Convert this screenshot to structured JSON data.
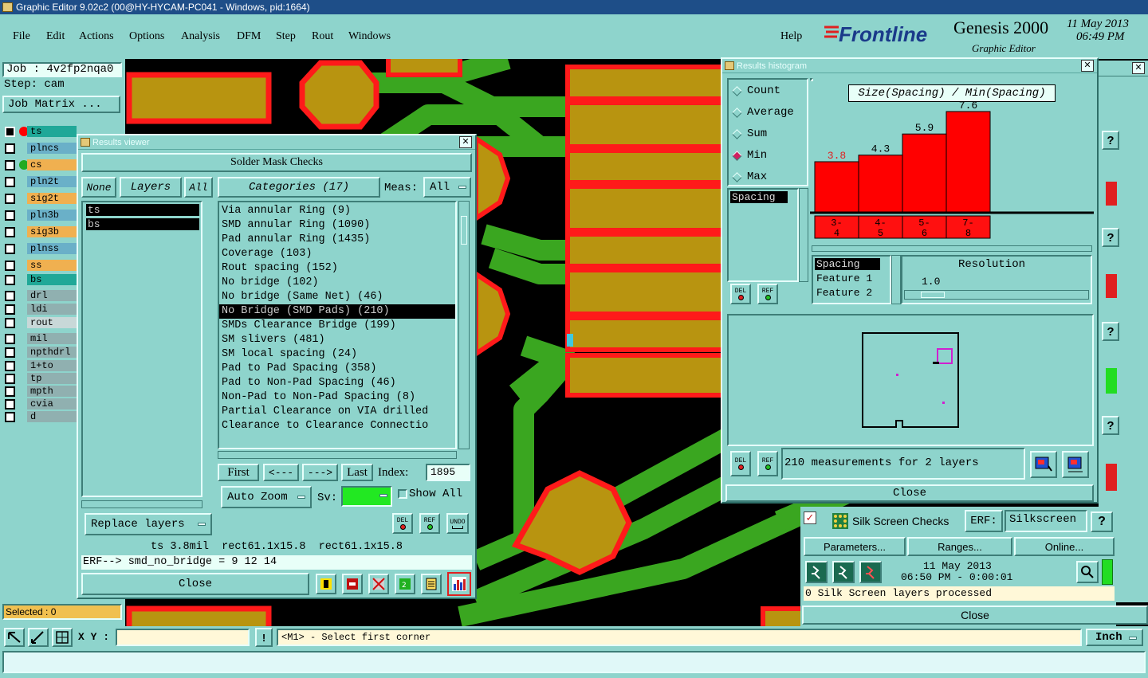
{
  "window": {
    "title": "Graphic Editor 9.02c2 (00@HY-HYCAM-PC041 - Windows, pid:1664)"
  },
  "menu": {
    "items": [
      "File",
      "Edit",
      "Actions",
      "Options",
      "Analysis",
      "DFM",
      "Step",
      "Rout",
      "Windows"
    ],
    "help": "Help"
  },
  "brand": {
    "logo": "Frontline",
    "product": "Genesis 2000",
    "subtitle": "Graphic Editor",
    "date": "11 May 2013",
    "time": "06:49 PM"
  },
  "job": {
    "job": "Job : 4v2fp2nqa0",
    "step": "Step: cam",
    "matrix_button": "Job Matrix ..."
  },
  "layers": [
    {
      "name": "ts",
      "color": "#20a898",
      "dot": "#ff0000"
    },
    {
      "name": "plncs",
      "color": "#6ab0c8"
    },
    {
      "name": "cs",
      "color": "#f0b050",
      "dot": "#22aa22"
    },
    {
      "name": "pln2t",
      "color": "#6ab0c8"
    },
    {
      "name": "sig2t",
      "color": "#f0b050"
    },
    {
      "name": "pln3b",
      "color": "#6ab0c8"
    },
    {
      "name": "sig3b",
      "color": "#f0b050"
    },
    {
      "name": "plnss",
      "color": "#6ab0c8"
    },
    {
      "name": "ss",
      "color": "#f0b050"
    },
    {
      "name": "bs",
      "color": "#20a898"
    },
    {
      "name": "drl",
      "color": "#90b0b0"
    },
    {
      "name": "ldi",
      "color": "#90b0b0"
    },
    {
      "name": "rout",
      "color": "#c8d8d8"
    },
    {
      "name": "mil",
      "color": "#90b0b0"
    },
    {
      "name": "npthdrl",
      "color": "#90b0b0"
    },
    {
      "name": "1+to",
      "color": "#90b0b0"
    },
    {
      "name": "tp",
      "color": "#90b0b0"
    },
    {
      "name": "mpth",
      "color": "#90b0b0"
    },
    {
      "name": "cvia",
      "color": "#90b0b0"
    },
    {
      "name": "d",
      "color": "#90b0b0"
    }
  ],
  "status": {
    "selected": "Selected : 0",
    "xy_label": "X Y :",
    "message": "<M1> - Select first corner",
    "units": "Inch"
  },
  "results_viewer": {
    "title": "Results viewer",
    "header": "Solder Mask Checks",
    "none_btn": "None",
    "layers_btn": "Layers",
    "all_btn": "All",
    "categories_btn": "Categories (17)",
    "meas_label": "Meas:",
    "meas_value": "All",
    "layer_list": [
      "ts",
      "bs"
    ],
    "categories": [
      "Via annular Ring (9)",
      "SMD annular Ring (1090)",
      "Pad annular Ring (1435)",
      "Coverage (103)",
      "Rout spacing (152)",
      "No bridge (102)",
      "No bridge (Same Net) (46)",
      "No Bridge (SMD Pads) (210)",
      "SMDs Clearance Bridge (199)",
      "SM slivers (481)",
      "SM local spacing (24)",
      "Pad to Pad Spacing (358)",
      "Pad to Non-Pad Spacing (46)",
      "Non-Pad to Non-Pad Spacing (8)",
      "Partial Clearance on VIA drilled",
      "Clearance to Clearance Connectio"
    ],
    "selected_index": 7,
    "nav": {
      "first": "First",
      "prev": "<---",
      "next": "--->",
      "last": "Last",
      "index_label": "Index:",
      "index_value": "1895"
    },
    "auto_zoom": "Auto Zoom",
    "sv_label": "Sv:",
    "show_all": "Show All",
    "replace_layers": "Replace layers",
    "del": "DEL",
    "ref": "REF",
    "undo": "UNDO",
    "info_line": "ts 3.8mil  rect61.1x15.8  rect61.1x15.8",
    "erf_line": "ERF--> smd_no_bridge = 9 12 14",
    "close": "Close"
  },
  "histogram": {
    "title": "Results histogram",
    "modes": [
      "Count",
      "Average",
      "Sum",
      "Min",
      "Max"
    ],
    "selected_mode": "Min",
    "chart_title": "Size(Spacing) / Min(Spacing)",
    "list_item": "Spacing",
    "field_list": [
      "Spacing",
      "Feature 1",
      "Feature 2"
    ],
    "resolution_label": "Resolution",
    "resolution_value": "1.0",
    "del": "DEL",
    "ref": "REF",
    "measurements": "210 measurements for 2 layers",
    "close": "Close"
  },
  "chart_data": {
    "type": "bar",
    "title": "Size(Spacing) / Min(Spacing)",
    "categories": [
      "3-4",
      "4-5",
      "5-6",
      "7-8"
    ],
    "tick_labels": [
      [
        "3-",
        "4"
      ],
      [
        "4-",
        "5"
      ],
      [
        "5-",
        "6"
      ],
      [
        "7-",
        "8"
      ]
    ],
    "values": [
      3.8,
      4.3,
      5.9,
      7.6
    ],
    "value_labels": [
      "3.8",
      "4.3",
      "5.9",
      "7.6"
    ],
    "highlight_index": 0,
    "bar_color": "#ff0000",
    "ylim": [
      0,
      7.6
    ]
  },
  "silk": {
    "title": "Silk Screen Checks",
    "erf_label": "ERF:",
    "erf_value": "Silkscreen",
    "help": "?",
    "parameters": "Parameters...",
    "ranges": "Ranges...",
    "online": "Online...",
    "date": "11 May 2013",
    "time": "06:50 PM - 0:00:01",
    "status": "0 Silk Screen layers processed",
    "close": "Close"
  }
}
